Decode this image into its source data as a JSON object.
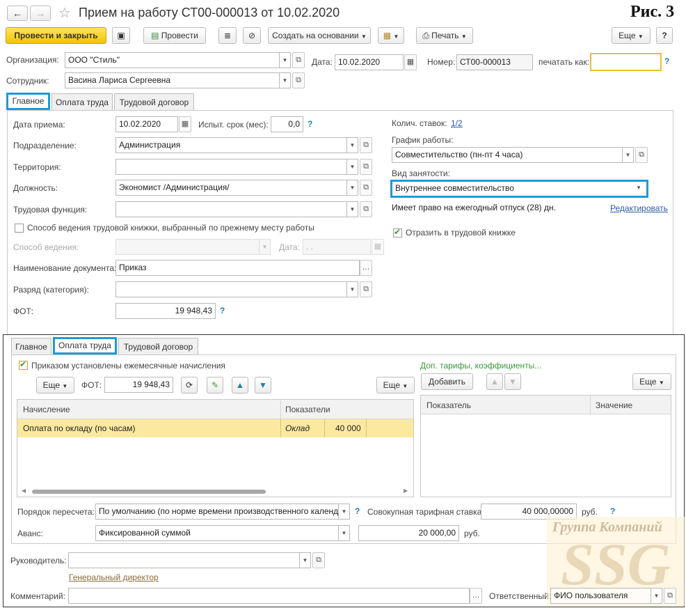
{
  "figure_label": "Рис. 3",
  "window": {
    "title": "Прием на работу СТ00-000013 от 10.02.2020"
  },
  "toolbar": {
    "post_close": "Провести и закрыть",
    "post": "Провести",
    "create_based": "Создать на основании",
    "print": "Печать",
    "more": "Еще",
    "help": "?"
  },
  "header": {
    "org_label": "Организация:",
    "org_value": "ООО \"Стиль\"",
    "date_label": "Дата:",
    "date_value": "10.02.2020",
    "number_label": "Номер:",
    "number_value": "СТ00-000013",
    "print_as_label": "печатать как:",
    "print_as_value": "",
    "employee_label": "Сотрудник:",
    "employee_value": "Васина Лариса Сергеевна"
  },
  "tabs": [
    "Главное",
    "Оплата труда",
    "Трудовой договор"
  ],
  "main": {
    "hire_date_label": "Дата приема:",
    "hire_date_value": "10.02.2020",
    "probation_label": "Испыт. срок (мес):",
    "probation_value": "0,0",
    "dept_label": "Подразделение:",
    "dept_value": "Администрация",
    "territory_label": "Территория:",
    "territory_value": "",
    "position_label": "Должность:",
    "position_value": "Экономист /Администрация/",
    "function_label": "Трудовая функция:",
    "function_value": "",
    "workbook_method_check": "Способ ведения трудовой книжки, выбранный по прежнему месту работы",
    "method_label": "Способ ведения:",
    "method_value": "",
    "method_date_label": "Дата:",
    "method_date_value": ". .",
    "doc_name_label": "Наименование документа:",
    "doc_name_value": "Приказ",
    "grade_label": "Разряд (категория):",
    "grade_value": "",
    "fot_label": "ФОТ:",
    "fot_value": "19 948,43",
    "rates_label": "Колич. ставок:",
    "rates_value": "1/2",
    "schedule_label": "График работы:",
    "schedule_value": "Совместительство (пн-пт 4 часа)",
    "employment_label": "Вид занятости:",
    "employment_value": "Внутреннее совместительство",
    "vacation_text": "Имеет право на ежегодный отпуск (28) дн.",
    "edit_link": "Редактировать",
    "reflect_check": "Отразить в трудовой книжке"
  },
  "pay": {
    "order_check": "Приказом установлены ежемесячные начисления",
    "extra_link": "Доп. тарифы, коэффициенты...",
    "more": "Еще",
    "fot_label": "ФОТ:",
    "fot_value": "19 948,43",
    "add_button": "Добавить",
    "left_cols": [
      "Начисление",
      "Показатели"
    ],
    "rows": [
      {
        "accrual": "Оплата по окладу (по часам)",
        "indicator": "Оклад",
        "value": "40 000"
      }
    ],
    "right_cols": [
      "Показатель",
      "Значение"
    ],
    "recalc_label": "Порядок пересчета:",
    "recalc_value": "По умолчанию (по норме времени производственного календаря)",
    "total_rate_label": "Совокупная тарифная ставка:",
    "total_rate_value": "40 000,00000",
    "rub": "руб.",
    "advance_label": "Аванс:",
    "advance_value": "Фиксированной суммой",
    "advance_amount": "20 000,00"
  },
  "footer": {
    "head_label": "Руководитель:",
    "head_value": "",
    "head_link": "Генеральный директор",
    "comment_label": "Комментарий:",
    "comment_value": "",
    "responsible_label": "Ответственный:",
    "responsible_value": "ФИО пользователя"
  },
  "watermark": {
    "line1": "Группа Компаний",
    "line2": "SSG"
  },
  "colors": {
    "accent": "#1e9ad6",
    "primary_button": "#f2c400",
    "selected_row": "#fbe9a0",
    "link": "#2a5da8",
    "green_link": "#3a9a3a"
  }
}
